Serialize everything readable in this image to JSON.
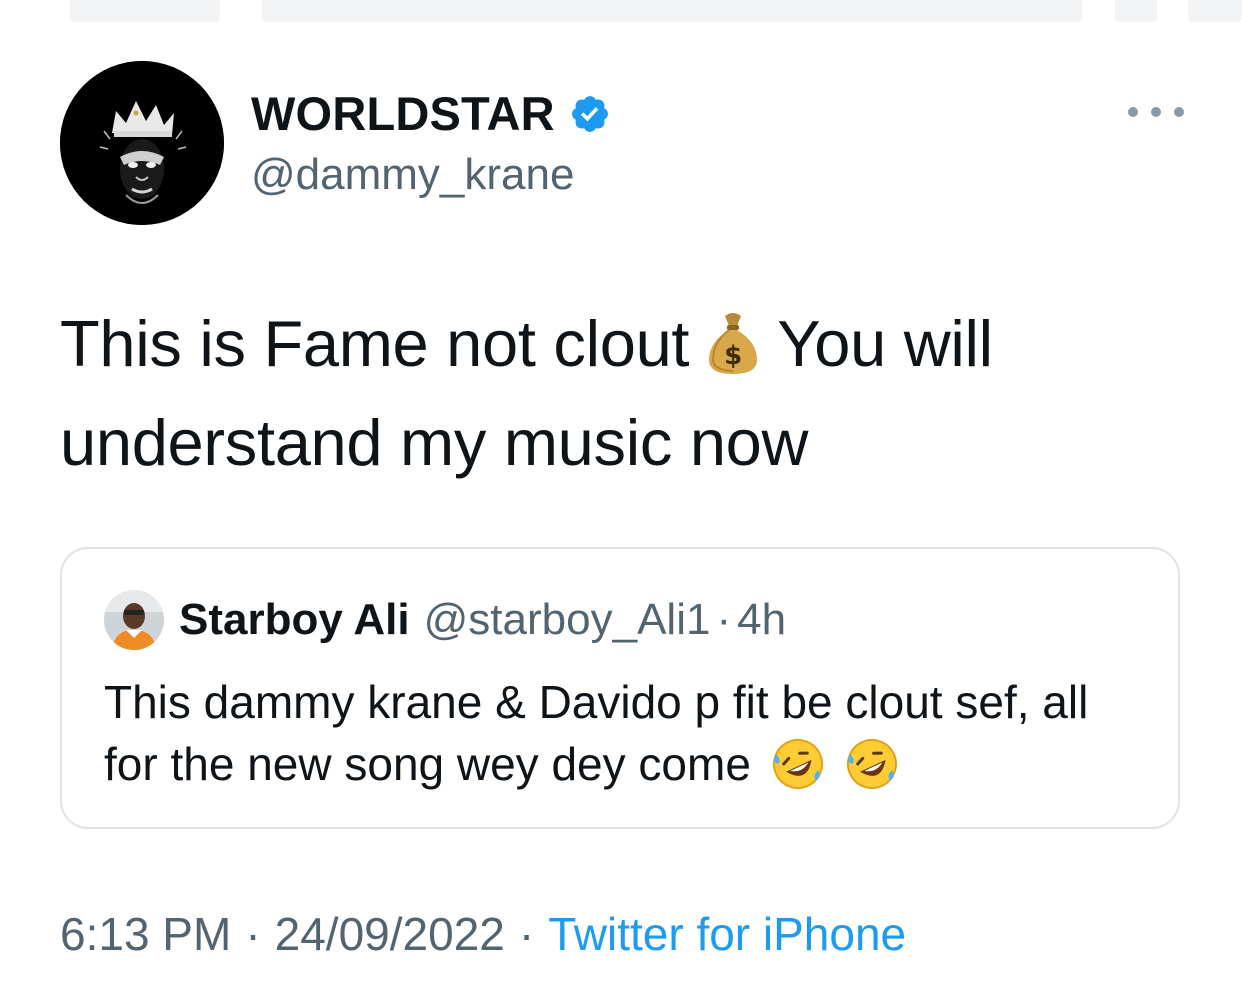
{
  "author": {
    "display_name": "WORLDSTAR",
    "handle": "@dammy_krane",
    "avatar_icon": "crowned-face-avatar",
    "verified_color": "#1d9bf0"
  },
  "tweet": {
    "text_part1": "This is Fame not clout",
    "emoji1": "money-bag-emoji",
    "text_part2": "You will understand my music now"
  },
  "quoted_tweet": {
    "display_name": "Starboy Ali",
    "handle": "@starboy_Ali1",
    "separator": "·",
    "time_ago": "4h",
    "text": "This dammy krane & Davido p fit be clout sef, all for the new song wey dey come",
    "emojis": [
      "rolling-on-floor-laughing-emoji",
      "rolling-on-floor-laughing-emoji"
    ]
  },
  "meta": {
    "time": "6:13 PM",
    "separator": "·",
    "date": "24/09/2022",
    "source": "Twitter for iPhone"
  },
  "colors": {
    "text_primary": "#0f1419",
    "text_secondary": "#536471",
    "link": "#1d9bf0",
    "border": "#dfe3e7"
  }
}
